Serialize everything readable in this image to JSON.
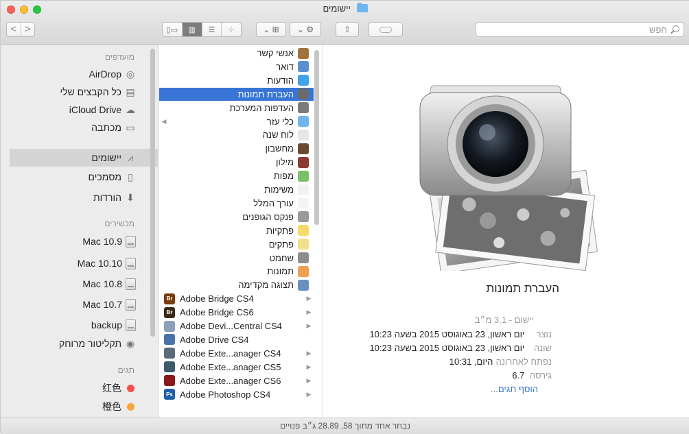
{
  "window": {
    "title": "יישומים"
  },
  "toolbar": {
    "back": "<",
    "forward": ">",
    "search_placeholder": "חפש"
  },
  "sidebar": {
    "favorites_header": "מועדפים",
    "favorites": [
      {
        "label": "AirDrop",
        "icon": "airdrop-icon"
      },
      {
        "label": "כל הקבצים שלי",
        "icon": "all-files-icon"
      },
      {
        "label": "iCloud Drive",
        "icon": "cloud-icon"
      },
      {
        "label": "מכתבה",
        "icon": "desktop-icon"
      },
      {
        "label": "יישומים",
        "icon": "applications-icon",
        "selected": true
      },
      {
        "label": "מסמכים",
        "icon": "documents-icon"
      },
      {
        "label": "הורדות",
        "icon": "downloads-icon"
      }
    ],
    "devices_header": "מכשירים",
    "devices": [
      {
        "label": "Mac 10.9",
        "icon": "disk-icon"
      },
      {
        "label": "Mac 10.10",
        "icon": "disk-icon"
      },
      {
        "label": "Mac 10.8",
        "icon": "disk-icon"
      },
      {
        "label": "Mac 10.7",
        "icon": "disk-icon"
      },
      {
        "label": "backup",
        "icon": "disk-icon"
      },
      {
        "label": "תקליטור מרוחק",
        "icon": "remote-disc-icon"
      }
    ],
    "tags_header": "תגים",
    "tags": [
      {
        "label": "红色",
        "color": "#f7504a"
      },
      {
        "label": "橙色",
        "color": "#f9a53c"
      }
    ]
  },
  "apps": [
    {
      "label": "אנשי קשר",
      "icon": "contacts-icon",
      "color": "#a0723c"
    },
    {
      "label": "דואר",
      "icon": "mail-icon",
      "color": "#5a8fcf"
    },
    {
      "label": "הודעות",
      "icon": "messages-icon",
      "color": "#3fa3e8"
    },
    {
      "label": "העברת תמונות",
      "icon": "image-capture-icon",
      "color": "#6a6a6a",
      "selected": true
    },
    {
      "label": "העדפות המערכת",
      "icon": "system-preferences-icon",
      "color": "#7b7b7b"
    },
    {
      "label": "כלי עזר",
      "icon": "utilities-folder-icon",
      "color": "#6fb6ef",
      "folder": true
    },
    {
      "label": "לוח שנה",
      "icon": "calendar-icon",
      "color": "#e6e6e6"
    },
    {
      "label": "מחשבון",
      "icon": "calculator-icon",
      "color": "#6b4a32"
    },
    {
      "label": "מילון",
      "icon": "dictionary-icon",
      "color": "#8b3a2f"
    },
    {
      "label": "מפות",
      "icon": "maps-icon",
      "color": "#7cbf6a"
    },
    {
      "label": "משימות",
      "icon": "reminders-icon",
      "color": "#f2f2f2"
    },
    {
      "label": "עורך המלל",
      "icon": "textedit-icon",
      "color": "#f4f4f4"
    },
    {
      "label": "פנקס הגופנים",
      "icon": "font-book-icon",
      "color": "#9a9a9a"
    },
    {
      "label": "פתקיות",
      "icon": "stickies-icon",
      "color": "#f6d96a"
    },
    {
      "label": "פתקים",
      "icon": "notes-icon",
      "color": "#f3e08a"
    },
    {
      "label": "שחמט",
      "icon": "chess-icon",
      "color": "#8d8d8d"
    },
    {
      "label": "תמונות",
      "icon": "photos-icon",
      "color": "#f0a050"
    },
    {
      "label": "תצוגה מקדימה",
      "icon": "preview-icon",
      "color": "#6a8fbf"
    },
    {
      "label": "Adobe Bridge CS4",
      "icon": "adobe-bridge-icon",
      "color": "#7a3a0a",
      "badge": "Br",
      "folder": true,
      "ltr": true
    },
    {
      "label": "Adobe Bridge CS6",
      "icon": "adobe-bridge-icon",
      "color": "#3a2a1a",
      "badge": "Br",
      "folder": true,
      "ltr": true
    },
    {
      "label": "Adobe Devi...Central CS4",
      "icon": "adobe-device-central-icon",
      "color": "#8ca0b8",
      "folder": true,
      "ltr": true
    },
    {
      "label": "Adobe Drive CS4",
      "icon": "adobe-drive-icon",
      "color": "#4a72a8",
      "ltr": true
    },
    {
      "label": "Adobe Exte...anager CS4",
      "icon": "adobe-extension-manager-icon",
      "color": "#5a6a7a",
      "folder": true,
      "ltr": true
    },
    {
      "label": "Adobe Exte...anager CS5",
      "icon": "adobe-extension-manager-icon",
      "color": "#3d5a6a",
      "folder": true,
      "ltr": true
    },
    {
      "label": "Adobe Exte...anager CS6",
      "icon": "adobe-extension-manager-icon",
      "color": "#8a1a1a",
      "folder": true,
      "ltr": true
    },
    {
      "label": "Adobe Photoshop CS4",
      "icon": "adobe-photoshop-icon",
      "color": "#1f5fa8",
      "badge": "Ps",
      "folder": true,
      "ltr": true
    }
  ],
  "preview": {
    "app_name": "העברת תמונות",
    "kind_label": "יישום - 3.1 מ״ב",
    "created_key": "נוצר",
    "created_value": "יום ראשון, 23 באוגוסט 2015 בשעה 10:23",
    "modified_key": "שונה",
    "modified_value": "יום ראשון, 23 באוגוסט 2015 בשעה 10:23",
    "opened_key": "נפתח לאחרונה",
    "opened_value": "היום, 10:31",
    "version_key": "גירסה",
    "version_value": "6.7",
    "add_tags": "הוסף תגים..."
  },
  "status": {
    "text": "נבחר אחד מתוך 58, 28.89 ג״ב פנויים"
  }
}
